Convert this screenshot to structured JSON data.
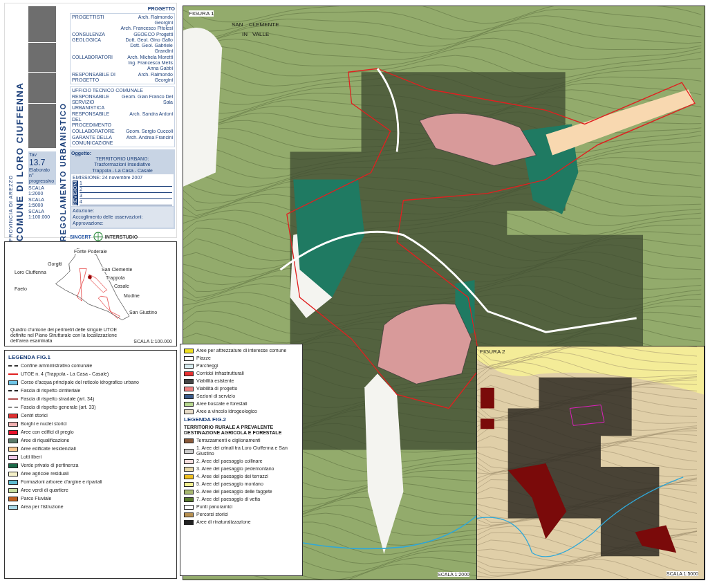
{
  "title_block": {
    "municipality": "COMUNE DI LORO CIUFFENNA",
    "province": "PROVINCIA DI AREZZO",
    "plan": "REGOLAMENTO URBANISTICO",
    "section": "PROGETTO",
    "credits": [
      {
        "role": "PROGETTISTI",
        "names": [
          "Arch. Raimondo Georgini",
          "Arch. Francesco Pitolesi"
        ]
      },
      {
        "role": "CONSULENZA GEOLOGICA",
        "names": [
          "GEOECO Progetti",
          "Dott. Geol. Gino Gallo",
          "Dott. Geol. Gabriele Grandini"
        ]
      },
      {
        "role": "COLLABORATORI",
        "names": [
          "Arch. Michela Moretti",
          "Ing. Francesca Melis",
          "Anna Gabbi"
        ]
      },
      {
        "role": "RESPONSABILE DI PROGETTO",
        "names": [
          "Arch. Raimondo Georgini"
        ]
      }
    ],
    "office_title": "UFFICIO TECNICO COMUNALE",
    "office": [
      {
        "role": "RESPONSABILE SERVIZIO URBANISTICA",
        "name": "Geom. Gian Franco Del Sala"
      },
      {
        "role": "RESPONSABILE DEL PROCEDIMENTO",
        "name": "Arch. Sandra Ardoni"
      },
      {
        "role": "COLLABORATORE",
        "name": "Geom. Sergio Cuccoli"
      },
      {
        "role": "GARANTE DELLA COMUNICAZIONE",
        "name": "Arch. Andrea Francini"
      }
    ],
    "subject_label": "Oggetto:",
    "subject_title": "TERRITORIO URBANO:",
    "subject_subtitle": "Trasformazioni Insediative",
    "places": "Trappola - La Casa - Casale",
    "emission": "EMISSIONE: 24 novembre 2007",
    "revisions_label": "REVISIONI",
    "revisions": [
      "1",
      "2",
      "3",
      "4"
    ],
    "procedure": [
      "Adozione:",
      "Accoglimento delle osservazioni:",
      "Approvazione:"
    ],
    "sheet_label": "Tav",
    "sheet_number": "13.7",
    "elaborato_label": "Elaborato",
    "progressive_label": "n° progressivo",
    "scales": [
      "SCALA 1:2000",
      "SCALA 1:5000",
      "SCALA 1:100.000"
    ],
    "certification": "SINCERT",
    "firm": "INTERSTUDIO"
  },
  "inset": {
    "labels": [
      "Fonte Poderale",
      "Gorgiti",
      "Loro Ciuffenna",
      "San Clemente",
      "Trappola",
      "Casale",
      "Modine",
      "San Giustino",
      "Faeto"
    ],
    "caption": "Quadro d'unione dei perimetri delle singole UTOE definite nel Piano Strutturale con la localizzazione dell'area esaminata",
    "scale": "SCALA 1:100.000"
  },
  "legend_fig1": {
    "title": "LEGENDA FIG.1",
    "items": [
      {
        "kind": "dash",
        "color": "#333333",
        "label": "Confine amministrativo comunale"
      },
      {
        "kind": "line",
        "color": "#e02020",
        "label": "UTOE n. 4 (Trappola - La Casa - Casale)"
      },
      {
        "kind": "fill",
        "color": "#6fc6e8",
        "label": "Corso d'acqua principale del reticolo idrografico urbano"
      },
      {
        "kind": "dash",
        "color": "#222222",
        "label": "Fascia di rispetto cimiteriale"
      },
      {
        "kind": "line",
        "color": "#b05050",
        "label": "Fascia di rispetto stradale (art. 34)"
      },
      {
        "kind": "dash",
        "color": "#888888",
        "label": "Fascia di rispetto generale (art. 33)"
      },
      {
        "kind": "fill",
        "color": "#e03030",
        "label": "Centri storici"
      },
      {
        "kind": "fill",
        "color": "#f0b0b0",
        "label": "Borghi e nuclei storici"
      },
      {
        "kind": "fill",
        "color": "#e8102a",
        "label": "Aree con edifici di pregio"
      },
      {
        "kind": "fill",
        "color": "#5a7a68",
        "label": "Aree di riqualificazione"
      },
      {
        "kind": "fill",
        "color": "#f8c890",
        "label": "Aree edificate residenziali"
      },
      {
        "kind": "fill",
        "color": "#f0c8e8",
        "label": "Lotti liberi"
      },
      {
        "kind": "fill",
        "color": "#1a6a48",
        "label": "Verde privato di pertinenza"
      },
      {
        "kind": "fill",
        "color": "#f4f0c8",
        "label": "Aree agricole residuali"
      },
      {
        "kind": "fill",
        "color": "#5fbcd0",
        "label": "Formazioni arboree d'argine e ripariali"
      },
      {
        "kind": "fill",
        "color": "#c8e0a0",
        "label": "Aree verdi di quartiere"
      },
      {
        "kind": "fill",
        "color": "#c06020",
        "label": "Parco Fluviale"
      },
      {
        "kind": "fill",
        "color": "#a8d8e8",
        "label": "Area per l'istruzione"
      }
    ]
  },
  "legend_mid": {
    "items": [
      {
        "kind": "fill",
        "color": "#f0e020",
        "label": "Aree per attrezzature di interesse comune"
      },
      {
        "kind": "fill",
        "color": "#ffffff",
        "label": "Piazze"
      },
      {
        "kind": "fill",
        "color": "#d8ecf0",
        "label": "Parcheggi"
      },
      {
        "kind": "fill",
        "color": "#e83030",
        "label": "Corridoi infrastrutturali"
      },
      {
        "kind": "fill",
        "color": "#444444",
        "label": "Viabilità esistente"
      },
      {
        "kind": "fill",
        "color": "#f08080",
        "label": "Viabilità di progetto"
      },
      {
        "kind": "fill",
        "color": "#3a5a8a",
        "label": "Sezioni di servizio"
      },
      {
        "kind": "fill",
        "color": "#b8d890",
        "label": "Aree boscate e forestali"
      },
      {
        "kind": "fill",
        "color": "#e8dcc8",
        "label": "Aree a vincolo idrogeologico"
      }
    ]
  },
  "legend_fig2": {
    "title": "LEGENDA FIG.2",
    "heading": "TERRITORIO RURALE A PREVALENTE DESTINAZIONE AGRICOLA E FORESTALE",
    "items": [
      {
        "kind": "fill",
        "color": "#8a5a3a",
        "label": "Terrazzamenti e ciglionamenti"
      },
      {
        "kind": "fill",
        "color": "#cccccc",
        "label": "1. Aree dei crinali tra Loro Ciuffenna e San Giustino"
      },
      {
        "kind": "fill",
        "color": "#f8dede",
        "label": "2. Aree del paesaggio collinare"
      },
      {
        "kind": "fill",
        "color": "#e8d8a8",
        "label": "3. Aree del paesaggio pedemontano"
      },
      {
        "kind": "fill",
        "color": "#f0c020",
        "label": "4. Aree del paesaggio dei terrazzi"
      },
      {
        "kind": "fill",
        "color": "#f4f090",
        "label": "5. Aree del paesaggio montano"
      },
      {
        "kind": "fill",
        "color": "#a8b870",
        "label": "6. Aree del paesaggio delle faggete"
      },
      {
        "kind": "fill",
        "color": "#5a7a30",
        "label": "7. Aree del paesaggio di vetta"
      },
      {
        "kind": "fill",
        "color": "#ffffff",
        "label": "Punti panoramici"
      },
      {
        "kind": "fill",
        "color": "#b89050",
        "label": "Percorsi storici"
      },
      {
        "kind": "fill",
        "color": "#222222",
        "label": "Aree di rinaturalizzazione"
      }
    ]
  },
  "figure1": {
    "title": "FIGURA 1",
    "labels": [
      "SAN",
      "CLEMENTE",
      "IN",
      "VALLE"
    ],
    "scale": "SCALA 1:2000"
  },
  "figure2": {
    "title": "FIGURA 2",
    "scale": "SCALA 1:5000"
  }
}
